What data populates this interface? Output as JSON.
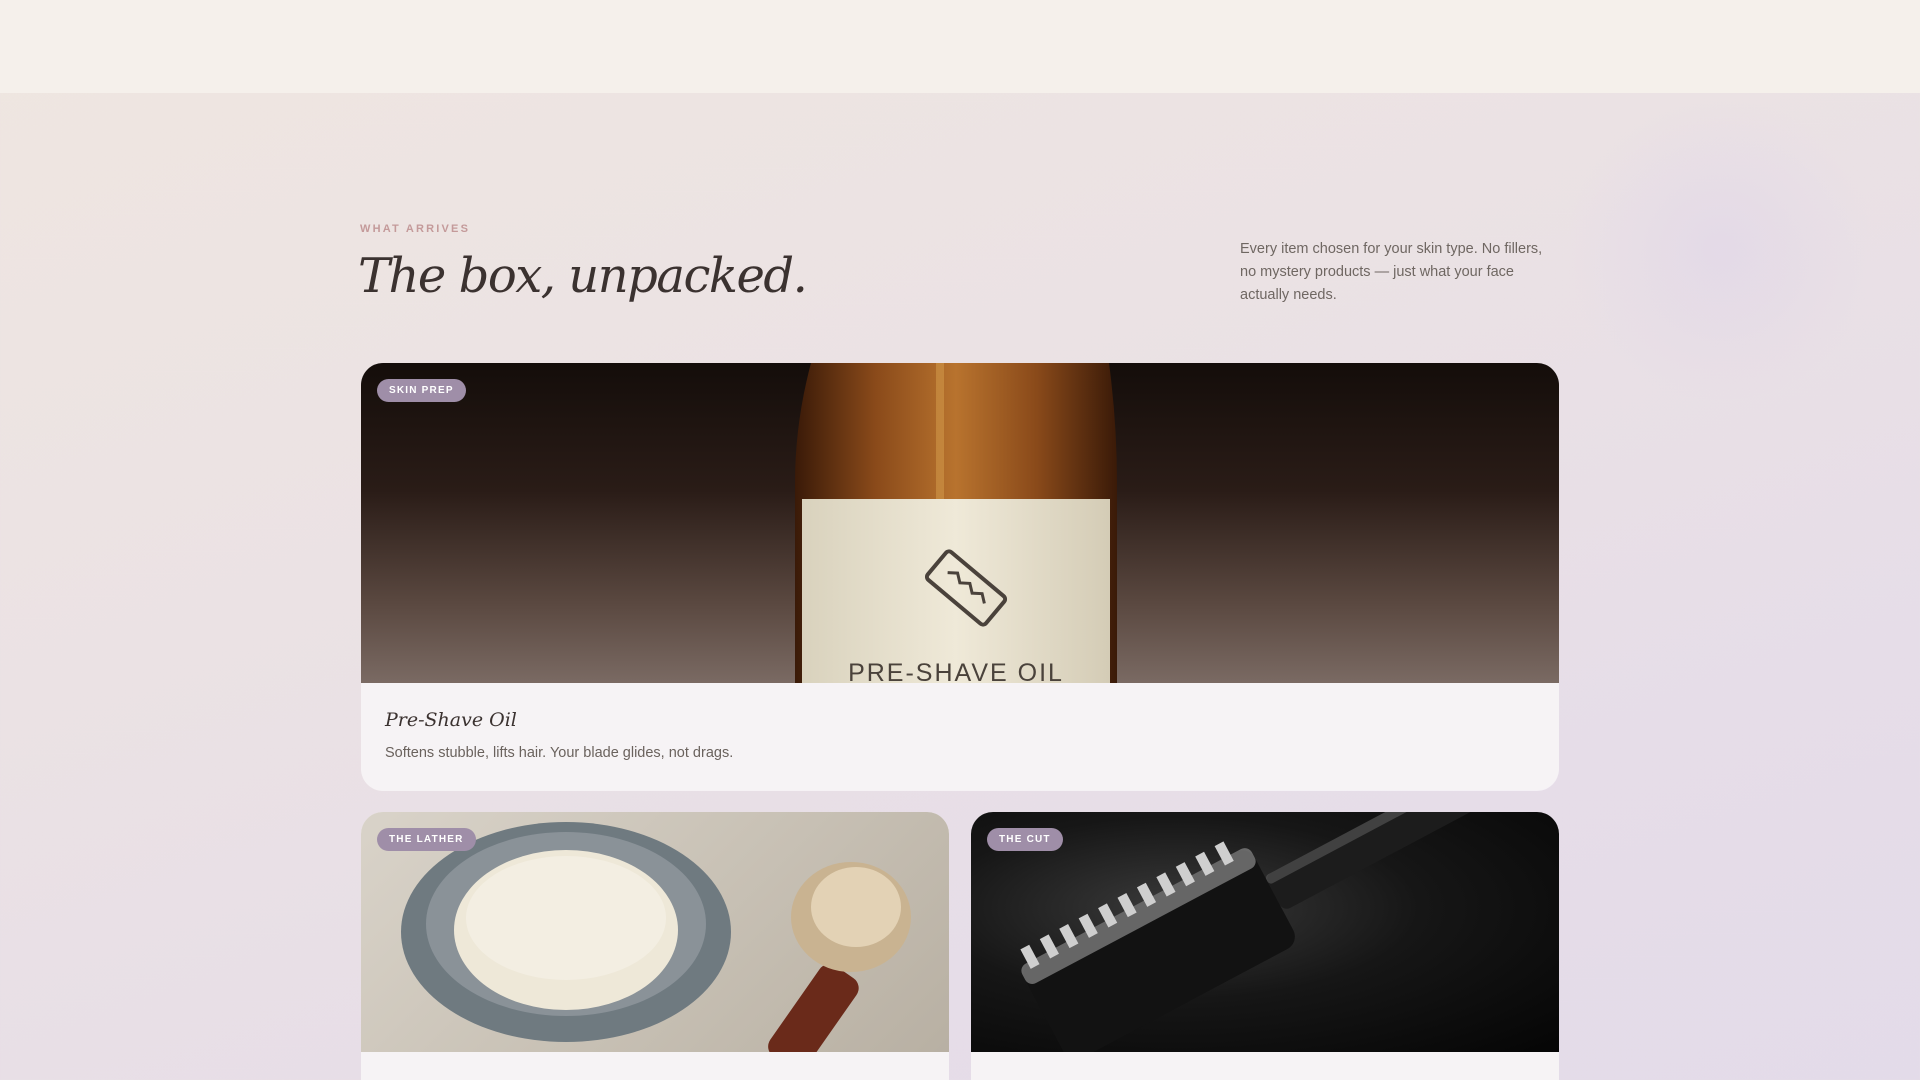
{
  "section": {
    "eyebrow": "WHAT ARRIVES",
    "title": "The box, unpacked.",
    "intro": "Every item chosen for your skin type. No fillers, no mystery products — just what your face actually needs."
  },
  "cards": [
    {
      "badge": "SKIN PREP",
      "title": "Pre-Shave Oil",
      "description": "Softens stubble, lifts hair. Your blade glides, not drags.",
      "image_label": "PRE-SHAVE OIL"
    },
    {
      "badge": "THE LATHER",
      "title": "",
      "description": ""
    },
    {
      "badge": "THE CUT",
      "title": "",
      "description": ""
    }
  ],
  "colors": {
    "badge": "#9f8ea8",
    "eyebrow": "#c49a9a",
    "heading": "#3b3230",
    "topbar": "#f5f0eb"
  }
}
